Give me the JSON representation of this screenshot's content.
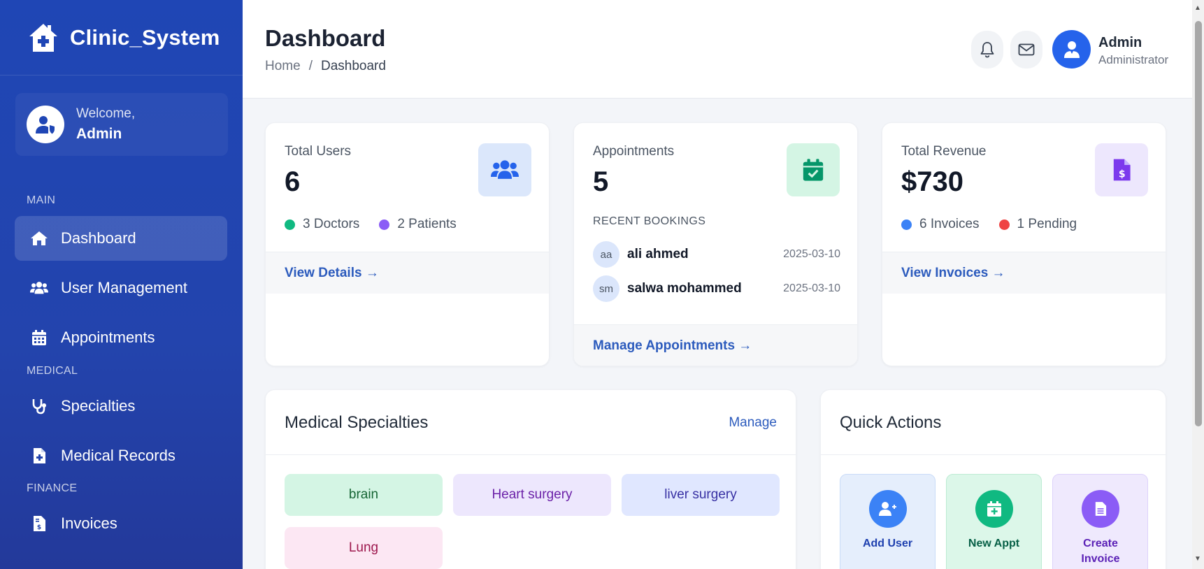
{
  "sidebar": {
    "brand": "Clinic_System",
    "welcome_small": "Welcome,",
    "welcome_name": "Admin",
    "sections": [
      "MAIN",
      "MEDICAL",
      "FINANCE"
    ],
    "items": [
      {
        "label": "Dashboard",
        "icon": "home-icon",
        "active": true
      },
      {
        "label": "User Management",
        "icon": "users-icon"
      },
      {
        "label": "Appointments",
        "icon": "calendar-icon"
      },
      {
        "label": "Specialties",
        "icon": "stethoscope-icon"
      },
      {
        "label": "Medical Records",
        "icon": "file-medical-icon"
      },
      {
        "label": "Invoices",
        "icon": "invoice-icon"
      }
    ]
  },
  "header": {
    "title": "Dashboard",
    "breadcrumb": [
      "Home",
      "/",
      "Dashboard"
    ],
    "user_name": "Admin",
    "user_role": "Administrator"
  },
  "stats": {
    "users": {
      "label": "Total Users",
      "value": "6",
      "stat1": "3 Doctors",
      "stat2": "2 Patients",
      "link": "View Details →"
    },
    "appointments": {
      "label": "Appointments",
      "value": "5",
      "recent_label": "RECENT BOOKINGS",
      "bookings": [
        {
          "initials": "aa",
          "name": "ali ahmed",
          "date": "2025-03-10"
        },
        {
          "initials": "sm",
          "name": "salwa mohammed",
          "date": "2025-03-10"
        }
      ],
      "link": "Manage Appointments →"
    },
    "revenue": {
      "label": "Total Revenue",
      "value": "$730",
      "stat1": "6 Invoices",
      "stat2": "1 Pending",
      "link": "View Invoices →"
    }
  },
  "specialties": {
    "title": "Medical Specialties",
    "manage": "Manage",
    "items": [
      "brain",
      "Heart surgery",
      "liver surgery",
      "Lung"
    ]
  },
  "quick_actions": {
    "title": "Quick Actions",
    "items": [
      {
        "label": "Add User",
        "icon": "user-plus-icon"
      },
      {
        "label": "New Appt",
        "icon": "calendar-plus-icon"
      },
      {
        "label": "Create Invoice",
        "icon": "document-icon"
      }
    ]
  },
  "colors": {
    "sidebar": "#1f46b5",
    "accent": "#2563eb",
    "link": "#2c5bbd",
    "green": "#10b981",
    "purple": "#8b5cf6",
    "blue": "#3b82f6",
    "red": "#ef4444"
  }
}
